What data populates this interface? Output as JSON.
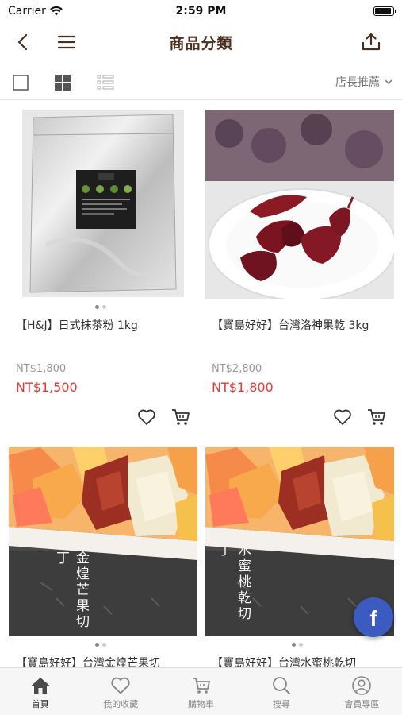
{
  "status_bar": {
    "carrier": "Carrier",
    "time": "2:59 PM",
    "battery_level": 0.9
  },
  "nav": {
    "title": "商品分類"
  },
  "toolbar": {
    "sort_label": "店長推薦"
  },
  "products": [
    {
      "name": "【H&J】日式抹茶粉 1kg",
      "original_price": "NT$1,800",
      "price": "NT$1,500",
      "image_count": 2,
      "active_image": 0
    },
    {
      "name": "【寶島好好】台灣洛神果乾 3kg",
      "original_price": "NT$2,800",
      "price": "NT$1,800",
      "image_count": 0,
      "active_image": 0
    },
    {
      "name": "【寶島好好】台灣金煌芒果切",
      "image_label": "金煌芒果切丁",
      "image_count": 2,
      "active_image": 0
    },
    {
      "name": "【寶島好好】台灣水蜜桃乾切",
      "image_label": "水蜜桃乾切丁",
      "image_count": 2,
      "active_image": 0
    }
  ],
  "tabs": [
    {
      "label": "首頁",
      "icon": "home-icon",
      "active": true
    },
    {
      "label": "我的收藏",
      "icon": "heart-icon",
      "active": false
    },
    {
      "label": "購物車",
      "icon": "cart-icon",
      "active": false
    },
    {
      "label": "搜尋",
      "icon": "search-icon",
      "active": false
    },
    {
      "label": "會員專區",
      "icon": "user-icon",
      "active": false
    }
  ],
  "colors": {
    "title": "#4a2e1e",
    "price": "#e53935",
    "facebook": "#3b5bc0"
  }
}
